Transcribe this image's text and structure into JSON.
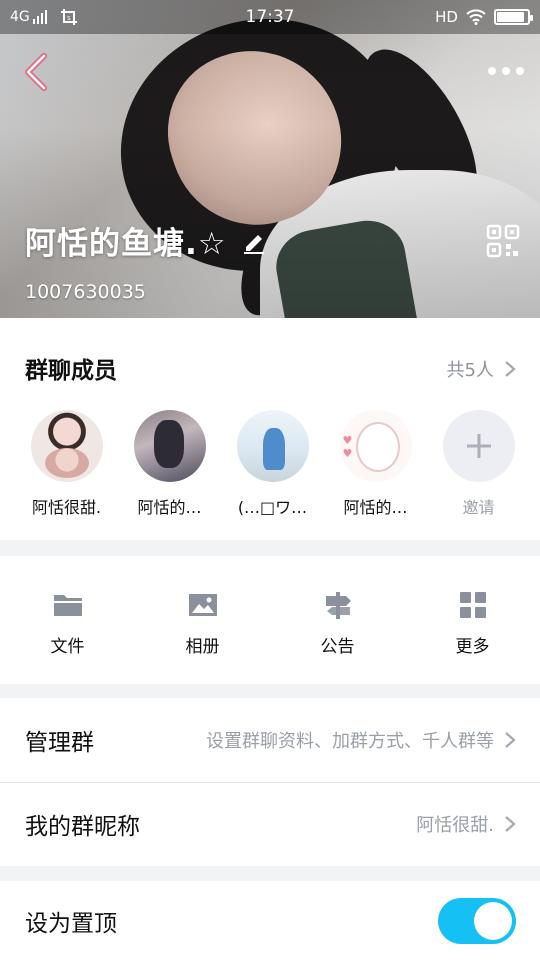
{
  "status_bar": {
    "network": "4G",
    "time": "17:37",
    "hd": "HD",
    "battery_level": 0.9
  },
  "header": {
    "group_name": "阿恬的鱼塘.☆",
    "group_id": "1007630035",
    "icons": {
      "back": "chevron-left-icon",
      "more": "more-dots-icon",
      "edit": "pencil-icon",
      "qr": "qr-code-icon"
    }
  },
  "members": {
    "title": "群聊成员",
    "count_label": "共5人",
    "list": [
      {
        "name": "阿恬很甜."
      },
      {
        "name": "阿恬的…"
      },
      {
        "name": "(…□ワ…"
      },
      {
        "name": "阿恬的…"
      }
    ],
    "invite_label": "邀请"
  },
  "tools": [
    {
      "label": "文件",
      "icon": "folder-icon"
    },
    {
      "label": "相册",
      "icon": "photo-album-icon"
    },
    {
      "label": "公告",
      "icon": "signpost-icon"
    },
    {
      "label": "更多",
      "icon": "grid-icon"
    }
  ],
  "settings": {
    "manage": {
      "title": "管理群",
      "detail": "设置群聊资料、加群方式、千人群等"
    },
    "nickname": {
      "title": "我的群昵称",
      "detail": "阿恬很甜."
    },
    "pin": {
      "title": "设为置顶",
      "enabled": true
    }
  },
  "colors": {
    "toggle_on": "#14c0f4",
    "muted_text": "#9aa0a8",
    "tool_icon": "#8a919d"
  }
}
